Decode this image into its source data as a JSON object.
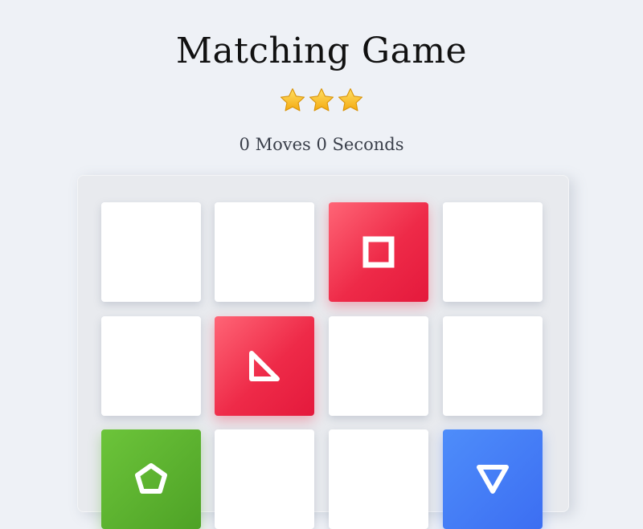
{
  "title": "Matching Game",
  "rating": {
    "stars": 3,
    "max": 3,
    "star_color": "#f5b91c"
  },
  "stats": {
    "moves": "0 Moves",
    "seconds": "0 Seconds"
  },
  "colors": {
    "background": "#eef1f6",
    "red": "#ee2a48",
    "green": "#4ea226",
    "blue": "#3c6ef2",
    "face_down": "#ffffff"
  },
  "cards": [
    {
      "state": "face-down",
      "icon": ""
    },
    {
      "state": "face-down",
      "icon": ""
    },
    {
      "state": "face-up",
      "color": "red",
      "icon": "square-icon"
    },
    {
      "state": "face-down",
      "icon": ""
    },
    {
      "state": "face-down",
      "icon": ""
    },
    {
      "state": "face-up",
      "color": "red",
      "icon": "triangle-icon"
    },
    {
      "state": "face-down",
      "icon": ""
    },
    {
      "state": "face-down",
      "icon": ""
    },
    {
      "state": "face-up",
      "color": "green",
      "icon": "pentagon-icon"
    },
    {
      "state": "face-down",
      "icon": ""
    },
    {
      "state": "face-down",
      "icon": ""
    },
    {
      "state": "face-up",
      "color": "blue",
      "icon": "down-triangle-icon"
    }
  ]
}
